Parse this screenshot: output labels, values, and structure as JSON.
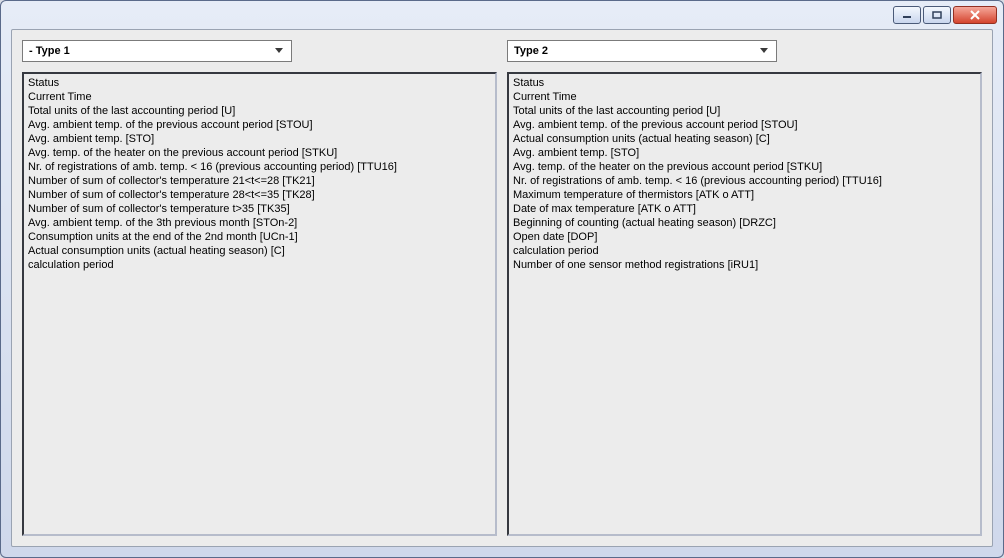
{
  "panes": [
    {
      "combo_label": "- Type 1",
      "items": [
        "Status",
        "Current Time",
        "Total units of the last accounting period [U]",
        "Avg. ambient temp. of the previous account period [STOU]",
        "Avg. ambient temp. [STO]",
        "Avg. temp. of the heater on the previous account period [STKU]",
        "Nr. of registrations of amb. temp. < 16 (previous accounting period) [TTU16]",
        "Number of sum of collector's temperature 21<t<=28 [TK21]",
        "Number of sum of collector's temperature 28<t<=35 [TK28]",
        "Number of sum of collector's temperature t>35 [TK35]",
        "Avg. ambient temp. of the 3th previous month [STOn-2]",
        "Consumption units at the end of the 2nd month [UCn-1]",
        "Actual consumption units (actual heating season) [C]",
        "calculation period"
      ]
    },
    {
      "combo_label": "Type 2",
      "items": [
        "Status",
        "Current Time",
        "Total units of the last accounting period [U]",
        "Avg. ambient temp. of the previous account period [STOU]",
        "Actual consumption units (actual heating season) [C]",
        "Avg. ambient temp. [STO]",
        "Avg. temp. of the heater on the previous account period [STKU]",
        "Nr. of registrations of amb. temp. < 16 (previous accounting period) [TTU16]",
        "Maximum temperature of thermistors  [ATK o ATT]",
        "Date of max temperature [ATK o ATT]",
        "Beginning of counting (actual  heating season) [DRZC]",
        "Open date [DOP]",
        "calculation period",
        "Number of one sensor method registrations [iRU1]"
      ]
    }
  ]
}
